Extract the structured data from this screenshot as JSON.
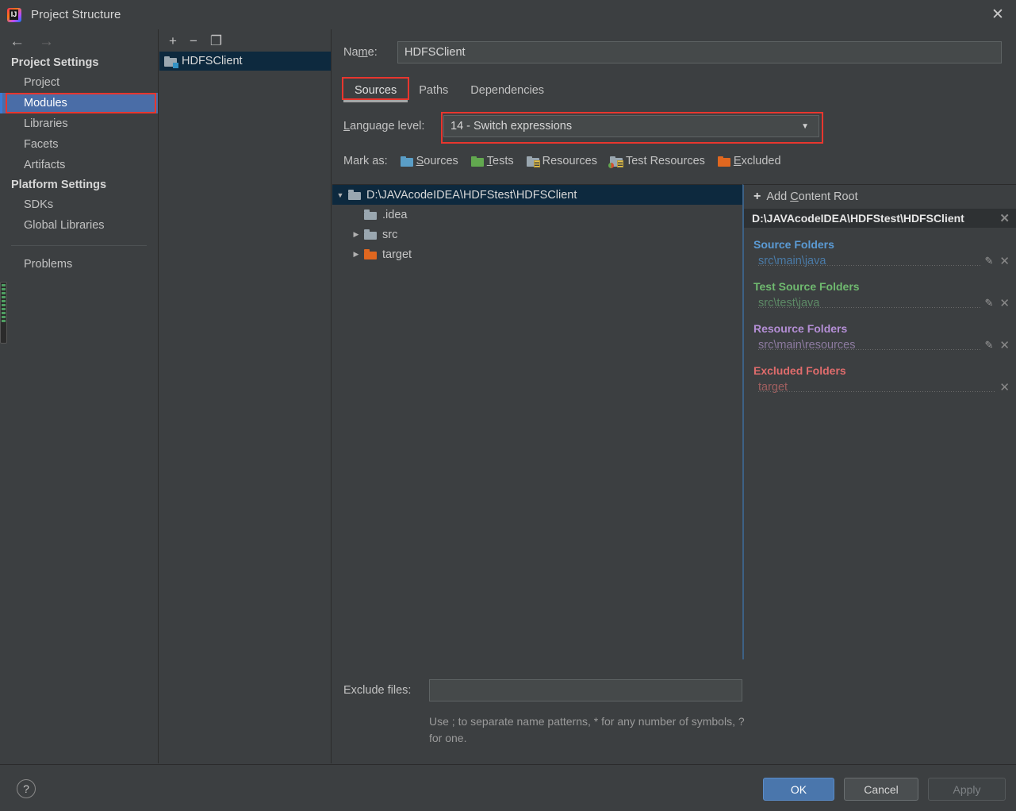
{
  "window": {
    "title": "Project Structure",
    "app_icon": "intellij-idea-icon",
    "close_label": "✕"
  },
  "sidebar": {
    "back_icon": "←",
    "forward_icon": "→",
    "groups": [
      {
        "label": "Project Settings",
        "items": [
          {
            "label": "Project",
            "selected": false
          },
          {
            "label": "Modules",
            "selected": true
          },
          {
            "label": "Libraries",
            "selected": false
          },
          {
            "label": "Facets",
            "selected": false
          },
          {
            "label": "Artifacts",
            "selected": false
          }
        ]
      },
      {
        "label": "Platform Settings",
        "items": [
          {
            "label": "SDKs",
            "selected": false
          },
          {
            "label": "Global Libraries",
            "selected": false
          }
        ]
      }
    ],
    "footer_item": "Problems"
  },
  "module_panel": {
    "toolbar": {
      "add": "+",
      "remove": "−",
      "copy": "❐"
    },
    "modules": [
      {
        "label": "HDFSClient",
        "selected": true
      }
    ]
  },
  "main": {
    "name_label": "Name:",
    "name_value": "HDFSClient",
    "tabs": [
      {
        "label": "Sources",
        "active": true
      },
      {
        "label": "Paths",
        "active": false
      },
      {
        "label": "Dependencies",
        "active": false
      }
    ],
    "language_level_label": "Language level:",
    "language_level_value": "14 - Switch expressions",
    "caret_icon": "▼",
    "mark_as": {
      "label": "Mark as:",
      "options": [
        {
          "label": "Sources",
          "color": "#5a9ec7"
        },
        {
          "label": "Tests",
          "color": "#62a84f"
        },
        {
          "label": "Resources",
          "color": "#9aa7b0"
        },
        {
          "label": "Test Resources",
          "color": "#9aa7b0"
        },
        {
          "label": "Excluded",
          "color": "#e0671f"
        }
      ]
    },
    "tree": [
      {
        "label": "D:\\JAVAcodeIDEA\\HDFStest\\HDFSClient",
        "indent": 0,
        "expander": "▼",
        "folder": "gray",
        "selected": true
      },
      {
        "label": ".idea",
        "indent": 1,
        "expander": "",
        "folder": "gray",
        "selected": false
      },
      {
        "label": "src",
        "indent": 1,
        "expander": "▶",
        "folder": "gray",
        "selected": false
      },
      {
        "label": "target",
        "indent": 1,
        "expander": "▶",
        "folder": "orange",
        "selected": false
      }
    ],
    "exclude_files_label": "Exclude files:",
    "exclude_files_value": "",
    "exclude_hint": "Use ; to separate name patterns, * for any number of symbols, ? for one."
  },
  "content_roots": {
    "add_label": "Add Content Root",
    "add_icon": "+",
    "root_path": "D:\\JAVAcodeIDEA\\HDFStest\\HDFSClient",
    "remove_icon": "✕",
    "groups": [
      {
        "title": "Source Folders",
        "path": "src\\main\\java",
        "color": "#5b9bd5",
        "edit_icon": "✎",
        "remove_icon": "✕",
        "has_edit": true
      },
      {
        "title": "Test Source Folders",
        "path": "src\\test\\java",
        "color": "#6fb96f",
        "edit_icon": "✎",
        "remove_icon": "✕",
        "has_edit": true
      },
      {
        "title": "Resource Folders",
        "path": "src\\main\\resources",
        "color": "#b58fd6",
        "edit_icon": "✎",
        "remove_icon": "✕",
        "has_edit": true
      },
      {
        "title": "Excluded Folders",
        "path": "target",
        "color": "#e06c6c",
        "edit_icon": "",
        "remove_icon": "✕",
        "has_edit": false
      }
    ]
  },
  "footer": {
    "help_label": "?",
    "ok_label": "OK",
    "cancel_label": "Cancel",
    "apply_label": "Apply"
  },
  "colors": {
    "background": "#3c3f41",
    "selection_blue": "#4a6da7",
    "tree_selection": "#0d293e",
    "highlight_red": "#e8362e",
    "ok_button": "#4a76ac"
  }
}
